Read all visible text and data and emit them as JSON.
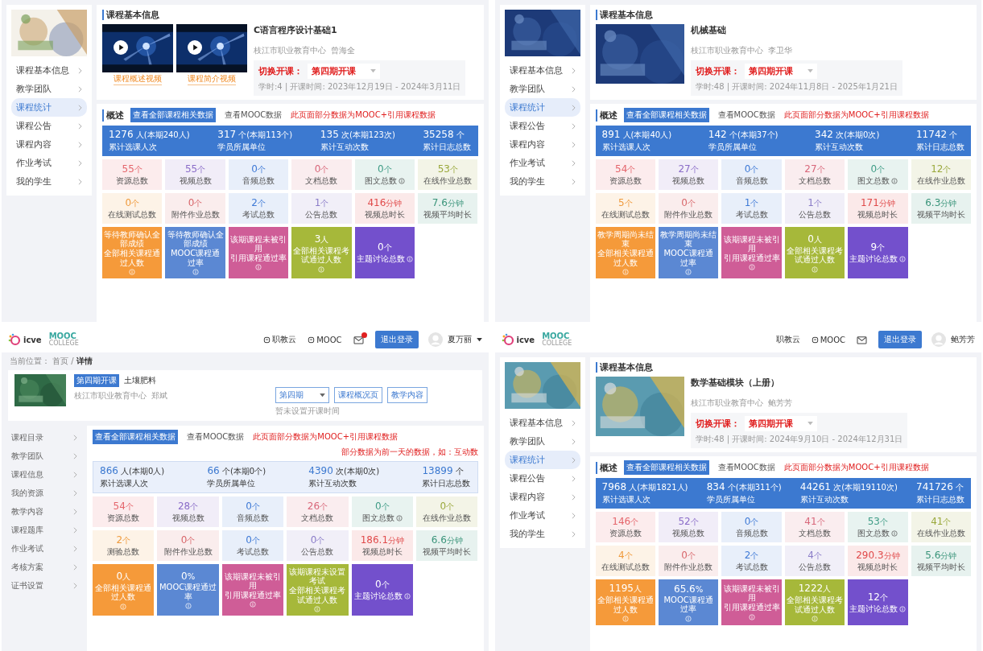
{
  "panels": [
    {
      "sidebar": {
        "items": [
          {
            "label": "课程基本信息",
            "selected": false
          },
          {
            "label": "教学团队",
            "selected": false
          },
          {
            "label": "课程统计",
            "selected": true
          },
          {
            "label": "课程公告",
            "selected": false
          },
          {
            "label": "课程内容",
            "selected": false
          },
          {
            "label": "作业考试",
            "selected": false
          },
          {
            "label": "我的学生",
            "selected": false
          }
        ]
      },
      "info": {
        "title": "课程基本信息",
        "media": [
          {
            "kind": "video",
            "caption": "课程概述视频"
          },
          {
            "kind": "video",
            "caption": "课程简介视频"
          }
        ],
        "course": "C语言程序设计基础1",
        "org": "枝江市职业教育中心",
        "teacher": "曾海全",
        "switch_label": "切换开课：",
        "term": "第四期开课",
        "meta": "学时:4 | 开课时间: 2023年12月19日 - 2024年3月11日"
      },
      "overview": {
        "title": "概述",
        "tabs": [
          {
            "label": "查看全部课程相关数据",
            "selected": true
          },
          {
            "label": "查看MOOC数据",
            "selected": false
          }
        ],
        "note": "此页面部分数据为MOOC+引用课程数据",
        "summary": {
          "kind": "solid",
          "items": [
            {
              "value": "1276",
              "unit": "人",
              "extra": "(本期240人)",
              "label": "累计选课人次"
            },
            {
              "value": "317",
              "unit": "个",
              "extra": "(本期113个)",
              "label": "学员所属单位"
            },
            {
              "value": "135",
              "unit": "次",
              "extra": "(本期123次)",
              "label": "累计互动次数"
            },
            {
              "value": "35258",
              "unit": "个",
              "label": "累计日志总数"
            }
          ]
        },
        "tiles": [
          {
            "kind": "light",
            "value": "55",
            "unit": "个",
            "label": "资源总数",
            "info": false,
            "color": "#e5656b"
          },
          {
            "kind": "light",
            "value": "55",
            "unit": "个",
            "label": "视频总数",
            "info": false,
            "color": "#8a6cc8"
          },
          {
            "kind": "light",
            "value": "0",
            "unit": "个",
            "label": "音频总数",
            "info": false,
            "color": "#3f7ad6"
          },
          {
            "kind": "light",
            "value": "0",
            "unit": "个",
            "label": "文档总数",
            "info": false,
            "color": "#d8677a"
          },
          {
            "kind": "light",
            "value": "0",
            "unit": "个",
            "label": "图文总数",
            "info": true,
            "color": "#3f9c86"
          },
          {
            "kind": "light",
            "value": "53",
            "unit": "个",
            "label": "在线作业总数",
            "info": false,
            "color": "#9aa83c"
          },
          {
            "kind": "light",
            "value": "0",
            "unit": "个",
            "label": "在线测试总数",
            "info": false,
            "color": "#ef9a3c"
          },
          {
            "kind": "light",
            "value": "0",
            "unit": "个",
            "label": "附件作业总数",
            "info": false,
            "color": "#d8676b"
          },
          {
            "kind": "light",
            "value": "2",
            "unit": "个",
            "label": "考试总数",
            "info": false,
            "color": "#3f7ad6"
          },
          {
            "kind": "light",
            "value": "1",
            "unit": "个",
            "label": "公告总数",
            "info": false,
            "color": "#8a7cc8"
          },
          {
            "kind": "light",
            "value": "416",
            "unit": "分钟",
            "label": "视频总时长",
            "info": false,
            "color": "#e04a4a"
          },
          {
            "kind": "light",
            "value": "7.6",
            "unit": "分钟",
            "label": "视频平均时长",
            "info": false,
            "color": "#3a947a"
          },
          {
            "kind": "solid",
            "note": "等待教师确认全部成绩",
            "label": "全部相关课程通过人数",
            "info": true,
            "color": "#f59a3a"
          },
          {
            "kind": "solid",
            "note": "等待教师确认全部成绩",
            "label": "MOOC课程通过率",
            "info": true,
            "color": "#5b88d3"
          },
          {
            "kind": "solid",
            "note": "该期课程未被引用",
            "label": "引用课程通过率",
            "info": true,
            "color": "#cf5d97"
          },
          {
            "kind": "solid",
            "value": "3",
            "unit": "人",
            "label": "全部相关课程考试通过人数",
            "info": true,
            "color": "#a6b83a"
          },
          {
            "kind": "solid",
            "value": "0",
            "unit": "个",
            "label": "主题讨论总数",
            "info": true,
            "color": "#7350cc"
          }
        ]
      }
    },
    {
      "sidebar": {
        "items": [
          {
            "label": "课程基本信息",
            "selected": false
          },
          {
            "label": "教学团队",
            "selected": false
          },
          {
            "label": "课程统计",
            "selected": true
          },
          {
            "label": "课程公告",
            "selected": false
          },
          {
            "label": "课程内容",
            "selected": false
          },
          {
            "label": "作业考试",
            "selected": false
          },
          {
            "label": "我的学生",
            "selected": false
          }
        ]
      },
      "info": {
        "title": "课程基本信息",
        "course": "机械基础",
        "org": "枝江市职业教育中心",
        "teacher": "李卫华",
        "switch_label": "切换开课：",
        "term": "第四期开课",
        "meta": "学时:48 | 开课时间: 2024年11月8日 - 2025年1月21日"
      },
      "overview": {
        "title": "概述",
        "tabs": [
          {
            "label": "查看全部课程相关数据",
            "selected": true
          },
          {
            "label": "查看MOOC数据",
            "selected": false
          }
        ],
        "note": "此页面部分数据为MOOC+引用课程数据",
        "summary": {
          "kind": "solid",
          "items": [
            {
              "value": "891",
              "unit": "人",
              "extra": "(本期40人)",
              "label": "累计选课人次"
            },
            {
              "value": "142",
              "unit": "个",
              "extra": "(本期37个)",
              "label": "学员所属单位"
            },
            {
              "value": "342",
              "unit": "次",
              "extra": "(本期0次)",
              "label": "累计互动次数"
            },
            {
              "value": "11742",
              "unit": "个",
              "label": "累计日志总数"
            }
          ]
        },
        "tiles": [
          {
            "kind": "light",
            "value": "54",
            "unit": "个",
            "label": "资源总数",
            "info": false,
            "color": "#e5656b"
          },
          {
            "kind": "light",
            "value": "27",
            "unit": "个",
            "label": "视频总数",
            "info": false,
            "color": "#8a6cc8"
          },
          {
            "kind": "light",
            "value": "0",
            "unit": "个",
            "label": "音频总数",
            "info": false,
            "color": "#3f7ad6"
          },
          {
            "kind": "light",
            "value": "27",
            "unit": "个",
            "label": "文档总数",
            "info": false,
            "color": "#d8677a"
          },
          {
            "kind": "light",
            "value": "0",
            "unit": "个",
            "label": "图文总数",
            "info": true,
            "color": "#3f9c86"
          },
          {
            "kind": "light",
            "value": "12",
            "unit": "个",
            "label": "在线作业总数",
            "info": false,
            "color": "#9aa83c"
          },
          {
            "kind": "light",
            "value": "5",
            "unit": "个",
            "label": "在线测试总数",
            "info": false,
            "color": "#ef9a3c"
          },
          {
            "kind": "light",
            "value": "0",
            "unit": "个",
            "label": "附件作业总数",
            "info": false,
            "color": "#d8676b"
          },
          {
            "kind": "light",
            "value": "1",
            "unit": "个",
            "label": "考试总数",
            "info": false,
            "color": "#3f7ad6"
          },
          {
            "kind": "light",
            "value": "1",
            "unit": "个",
            "label": "公告总数",
            "info": false,
            "color": "#8a7cc8"
          },
          {
            "kind": "light",
            "value": "171",
            "unit": "分钟",
            "label": "视频总时长",
            "info": false,
            "color": "#e04a4a"
          },
          {
            "kind": "light",
            "value": "6.3",
            "unit": "分钟",
            "label": "视频平均时长",
            "info": false,
            "color": "#3a947a"
          },
          {
            "kind": "solid",
            "note": "教学周期尚未结束",
            "label": "全部相关课程通过人数",
            "info": true,
            "color": "#f59a3a"
          },
          {
            "kind": "solid",
            "note": "教学周期尚未结束",
            "label": "MOOC课程通过率",
            "info": true,
            "color": "#5b88d3"
          },
          {
            "kind": "solid",
            "note": "该期课程未被引用",
            "label": "引用课程通过率",
            "info": true,
            "color": "#cf5d97"
          },
          {
            "kind": "solid",
            "value": "0",
            "unit": "人",
            "label": "全部相关课程考试通过人数",
            "info": true,
            "color": "#a6b83a"
          },
          {
            "kind": "solid",
            "value": "9",
            "unit": "个",
            "label": "主题讨论总数",
            "info": true,
            "color": "#7350cc"
          }
        ]
      }
    },
    {
      "header": {
        "logo": {
          "brand": "icve",
          "mooc": "MOOC",
          "college": "COLLEGE"
        },
        "links": [
          {
            "label": "职教云",
            "icon": true
          },
          {
            "label": "MOOC",
            "icon": true
          }
        ],
        "notification": true,
        "logout": "退出登录",
        "user": "夏万丽",
        "caret": true
      },
      "breadcrumb": "当前位置： 首页 / **详情**",
      "course_card": {
        "status": "第四期开课",
        "course": "土壤肥料",
        "org": "枝江市职业教育中心",
        "teacher": "郑斌",
        "term": "第四期",
        "hint": "暂未设置开课时间",
        "buttons": [
          "课程概况页",
          "教学内容"
        ]
      },
      "sidebar": {
        "items": [
          {
            "label": "课程目录",
            "selected": false
          },
          {
            "label": "教学团队",
            "selected": false
          },
          {
            "label": "课程信息",
            "selected": false
          },
          {
            "label": "我的资源",
            "selected": false
          },
          {
            "label": "教学内容",
            "selected": false
          },
          {
            "label": "课程题库",
            "selected": false
          },
          {
            "label": "作业考试",
            "selected": false
          },
          {
            "label": "考核方案",
            "selected": false
          },
          {
            "label": "证书设置",
            "selected": false
          }
        ]
      },
      "overview": {
        "tabs": [
          {
            "label": "查看全部课程相关数据",
            "selected": true
          },
          {
            "label": "查看MOOC数据",
            "selected": false
          }
        ],
        "note": "此页面部分数据为MOOC+引用课程数据",
        "right_note": "部分数据为前一天的数据，如：互动数",
        "summary": {
          "kind": "light",
          "items": [
            {
              "value": "866",
              "unit": "人",
              "extra": "(本期0人)",
              "label": "累计选课人次"
            },
            {
              "value": "66",
              "unit": "个",
              "extra": "(本期0个)",
              "label": "学员所属单位"
            },
            {
              "value": "4390",
              "unit": "次",
              "extra": "(本期0次)",
              "label": "累计互动次数"
            },
            {
              "value": "13899",
              "unit": "个",
              "label": "累计日志总数"
            }
          ]
        },
        "tiles": [
          {
            "kind": "light",
            "value": "54",
            "unit": "个",
            "label": "资源总数",
            "info": false,
            "color": "#e5656b"
          },
          {
            "kind": "light",
            "value": "28",
            "unit": "个",
            "label": "视频总数",
            "info": false,
            "color": "#8a6cc8"
          },
          {
            "kind": "light",
            "value": "0",
            "unit": "个",
            "label": "音频总数",
            "info": false,
            "color": "#3f7ad6"
          },
          {
            "kind": "light",
            "value": "26",
            "unit": "个",
            "label": "文档总数",
            "info": false,
            "color": "#d8677a"
          },
          {
            "kind": "light",
            "value": "0",
            "unit": "个",
            "label": "图文总数",
            "info": true,
            "color": "#3f9c86"
          },
          {
            "kind": "light",
            "value": "0",
            "unit": "个",
            "label": "在线作业总数",
            "info": false,
            "color": "#9aa83c"
          },
          {
            "kind": "light",
            "value": "2",
            "unit": "个",
            "label": "测验总数",
            "info": false,
            "color": "#ef9a3c"
          },
          {
            "kind": "light",
            "value": "0",
            "unit": "个",
            "label": "附件作业总数",
            "info": false,
            "color": "#d8676b"
          },
          {
            "kind": "light",
            "value": "0",
            "unit": "个",
            "label": "考试总数",
            "info": false,
            "color": "#3f7ad6"
          },
          {
            "kind": "light",
            "value": "0",
            "unit": "个",
            "label": "公告总数",
            "info": false,
            "color": "#8a7cc8"
          },
          {
            "kind": "light",
            "value": "186.1",
            "unit": "分钟",
            "label": "视频总时长",
            "info": false,
            "color": "#e04a4a"
          },
          {
            "kind": "light",
            "value": "6.6",
            "unit": "分钟",
            "label": "视频平均时长",
            "info": false,
            "color": "#3a947a"
          },
          {
            "kind": "solid",
            "value": "0",
            "unit": "人",
            "label": "全部相关课程通过人数",
            "info": true,
            "color": "#f59a3a"
          },
          {
            "kind": "solid",
            "value": "0",
            "unit": "%",
            "label": "MOOC课程通过率",
            "info": true,
            "color": "#5b88d3"
          },
          {
            "kind": "solid",
            "note": "该期课程未被引用",
            "label": "引用课程通过率",
            "info": true,
            "color": "#cf5d97"
          },
          {
            "kind": "solid",
            "note": "该期课程未设置考试",
            "label": "全部相关课程考试通过人数",
            "info": true,
            "color": "#a6b83a"
          },
          {
            "kind": "solid",
            "value": "0",
            "unit": "个",
            "label": "主题讨论总数",
            "info": true,
            "color": "#7350cc"
          }
        ]
      }
    },
    {
      "header": {
        "logo": {
          "brand": "icve",
          "mooc": "MOOC",
          "college": "COLLEGE"
        },
        "links": [
          {
            "label": "职教云",
            "icon": false
          },
          {
            "label": "MOOC",
            "icon": true
          }
        ],
        "notification": false,
        "logout": "退出登录",
        "user": "鲍芳芳",
        "caret": false
      },
      "sidebar": {
        "items": [
          {
            "label": "课程基本信息",
            "selected": false
          },
          {
            "label": "教学团队",
            "selected": false
          },
          {
            "label": "课程统计",
            "selected": true
          },
          {
            "label": "课程公告",
            "selected": false
          },
          {
            "label": "课程内容",
            "selected": false
          },
          {
            "label": "作业考试",
            "selected": false
          },
          {
            "label": "我的学生",
            "selected": false
          }
        ]
      },
      "info": {
        "title": "课程基本信息",
        "course": "数学基础模块（上册）",
        "org": "枝江市职业教育中心",
        "teacher": "鲍芳芳",
        "switch_label": "切换开课：",
        "term": "第四期开课",
        "meta": "学时:48 | 开课时间: 2024年9月10日 - 2024年12月31日"
      },
      "overview": {
        "title": "概述",
        "tabs": [
          {
            "label": "查看全部课程相关数据",
            "selected": true
          },
          {
            "label": "查看MOOC数据",
            "selected": false
          }
        ],
        "note": "此页面部分数据为MOOC+引用课程数据",
        "summary": {
          "kind": "solid",
          "items": [
            {
              "value": "7968",
              "unit": "人",
              "extra": "(本期1821人)",
              "label": "累计选课人次"
            },
            {
              "value": "834",
              "unit": "个",
              "extra": "(本期311个)",
              "label": "学员所属单位"
            },
            {
              "value": "44261",
              "unit": "次",
              "extra": "(本期19110次)",
              "label": "累计互动次数"
            },
            {
              "value": "741726",
              "unit": "个",
              "label": "累计日志总数"
            }
          ]
        },
        "tiles": [
          {
            "kind": "light",
            "value": "146",
            "unit": "个",
            "label": "资源总数",
            "info": false,
            "color": "#e5656b"
          },
          {
            "kind": "light",
            "value": "52",
            "unit": "个",
            "label": "视频总数",
            "info": false,
            "color": "#8a6cc8"
          },
          {
            "kind": "light",
            "value": "0",
            "unit": "个",
            "label": "音频总数",
            "info": false,
            "color": "#3f7ad6"
          },
          {
            "kind": "light",
            "value": "41",
            "unit": "个",
            "label": "文档总数",
            "info": false,
            "color": "#d8677a"
          },
          {
            "kind": "light",
            "value": "53",
            "unit": "个",
            "label": "图文总数",
            "info": true,
            "color": "#3f9c86"
          },
          {
            "kind": "light",
            "value": "41",
            "unit": "个",
            "label": "在线作业总数",
            "info": false,
            "color": "#9aa83c"
          },
          {
            "kind": "light",
            "value": "4",
            "unit": "个",
            "label": "在线测试总数",
            "info": false,
            "color": "#ef9a3c"
          },
          {
            "kind": "light",
            "value": "0",
            "unit": "个",
            "label": "附件作业总数",
            "info": false,
            "color": "#d8676b"
          },
          {
            "kind": "light",
            "value": "2",
            "unit": "个",
            "label": "考试总数",
            "info": false,
            "color": "#3f7ad6"
          },
          {
            "kind": "light",
            "value": "4",
            "unit": "个",
            "label": "公告总数",
            "info": false,
            "color": "#8a7cc8"
          },
          {
            "kind": "light",
            "value": "290.3",
            "unit": "分钟",
            "label": "视频总时长",
            "info": false,
            "color": "#e04a4a"
          },
          {
            "kind": "light",
            "value": "5.6",
            "unit": "分钟",
            "label": "视频平均时长",
            "info": false,
            "color": "#3a947a"
          },
          {
            "kind": "solid",
            "value": "1195",
            "unit": "人",
            "label": "全部相关课程通过人数",
            "info": true,
            "color": "#f59a3a"
          },
          {
            "kind": "solid",
            "value": "65.6",
            "unit": "%",
            "label": "MOOC课程通过率",
            "info": true,
            "color": "#5b88d3"
          },
          {
            "kind": "solid",
            "note": "该期课程未被引用",
            "label": "引用课程通过率",
            "info": true,
            "color": "#cf5d97"
          },
          {
            "kind": "solid",
            "value": "1222",
            "unit": "人",
            "label": "全部相关课程考试通过人数",
            "info": true,
            "color": "#a6b83a"
          },
          {
            "kind": "solid",
            "value": "12",
            "unit": "个",
            "label": "主题讨论总数",
            "info": true,
            "color": "#7350cc"
          }
        ]
      }
    }
  ]
}
